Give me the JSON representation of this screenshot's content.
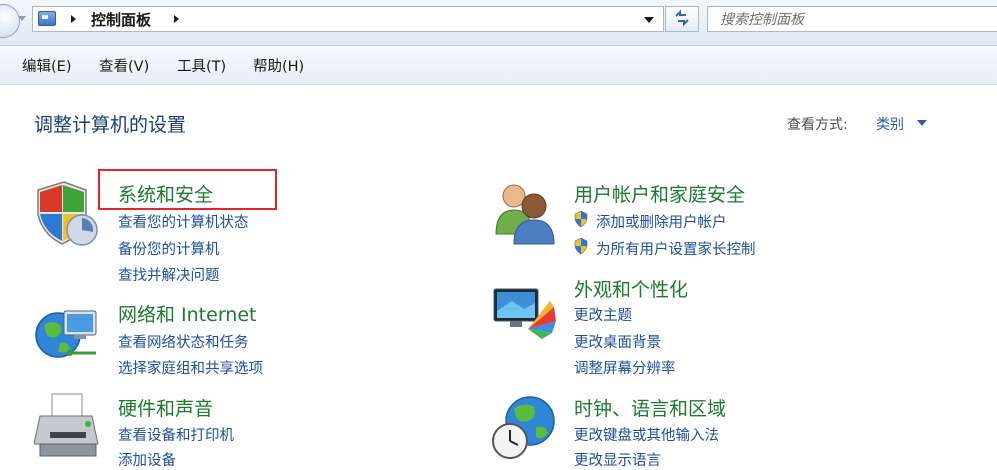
{
  "address_bar": {
    "breadcrumb": "控制面板",
    "search_placeholder": "搜索控制面板"
  },
  "menu": {
    "items": [
      "编辑(E)",
      "查看(V)",
      "工具(T)",
      "帮助(H)"
    ]
  },
  "page": {
    "title": "调整计算机的设置",
    "view_label": "查看方式:",
    "view_value": "类别"
  },
  "categories": [
    {
      "title": "系统和安全",
      "icon": "security-shield-icon",
      "links": [
        "查看您的计算机状态",
        "备份您的计算机",
        "查找并解决问题"
      ]
    },
    {
      "title": "网络和 Internet",
      "icon": "network-globe-icon",
      "links": [
        "查看网络状态和任务",
        "选择家庭组和共享选项"
      ]
    },
    {
      "title": "硬件和声音",
      "icon": "printer-icon",
      "links": [
        "查看设备和打印机",
        "添加设备"
      ]
    },
    {
      "title": "用户帐户和家庭安全",
      "icon": "users-icon",
      "links": [
        "添加或删除用户帐户",
        "为所有用户设置家长控制"
      ]
    },
    {
      "title": "外观和个性化",
      "icon": "monitor-palette-icon",
      "links": [
        "更改主题",
        "更改桌面背景",
        "调整屏幕分辨率"
      ]
    },
    {
      "title": "时钟、语言和区域",
      "icon": "globe-clock-icon",
      "links": [
        "更改键盘或其他输入法",
        "更改显示语言"
      ]
    }
  ],
  "colors": {
    "category_title": "#1c7a2f",
    "link": "#1f4fa0",
    "page_title": "#1e3f78",
    "highlight": "#e0262a"
  }
}
